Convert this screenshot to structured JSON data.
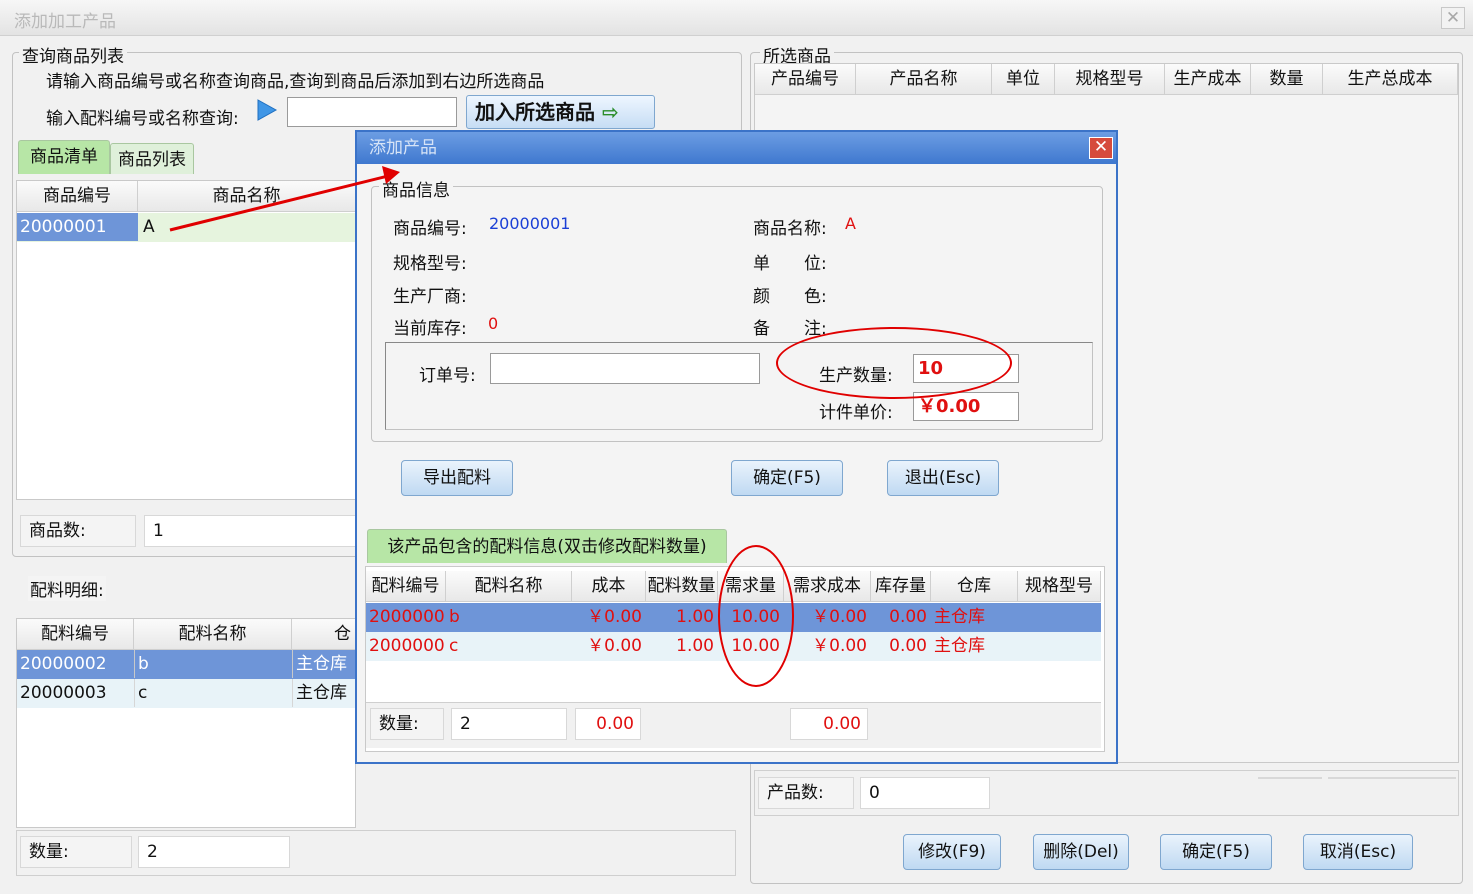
{
  "window": {
    "title": "添加加工产品",
    "close": "✕"
  },
  "query": {
    "legend": "查询商品列表",
    "hint": "请输入商品编号或名称查询商品,查询到商品后添加到右边所选商品",
    "search_label": "输入配料编号或名称查询:",
    "search_value": "",
    "add_button": "加入所选商品"
  },
  "tabs": [
    "商品清单",
    "商品列表"
  ],
  "product_table": {
    "headers": [
      "商品编号",
      "商品名称"
    ],
    "rows": [
      [
        "20000001",
        "A"
      ]
    ],
    "count_label": "商品数:",
    "count_value": "1"
  },
  "ingredients": {
    "label": "配料明细:",
    "headers": [
      "配料编号",
      "配料名称",
      "仓"
    ],
    "rows": [
      [
        "20000002",
        "b",
        "主仓库"
      ],
      [
        "20000003",
        "c",
        "主仓库"
      ]
    ],
    "count_label": "数量:",
    "count_value": "2"
  },
  "selected": {
    "legend": "所选商品",
    "headers": [
      "产品编号",
      "产品名称",
      "单位",
      "规格型号",
      "生产成本",
      "数量",
      "生产总成本"
    ],
    "count_label": "产品数:",
    "count_value": "0",
    "buttons": {
      "edit": "修改(F9)",
      "delete": "删除(Del)",
      "ok": "确定(F5)",
      "cancel": "取消(Esc)"
    }
  },
  "dialog": {
    "title": "添加产品",
    "close": "✕",
    "info_legend": "商品信息",
    "code_label": "商品编号:",
    "code_value": "20000001",
    "name_label": "商品名称:",
    "name_value": "A",
    "spec_label": "规格型号:",
    "unit_label": "单　　位:",
    "maker_label": "生产厂商:",
    "color_label": "颜　　色:",
    "stock_label": "当前库存:",
    "stock_value": "0",
    "note_label": "备　　注:",
    "order_label": "订单号:",
    "order_value": "",
    "qty_label": "生产数量:",
    "qty_value": "10",
    "price_label": "计件单价:",
    "price_value": "￥0.00",
    "btn_export": "导出配料",
    "btn_ok": "确定(F5)",
    "btn_exit": "退出(Esc)",
    "ingr_tab": "该产品包含的配料信息(双击修改配料数量)",
    "ingr_headers": [
      "配料编号",
      "配料名称",
      "成本",
      "配料数量",
      "需求量",
      "需求成本",
      "库存量",
      "仓库",
      "规格型号"
    ],
    "ingr_rows": [
      [
        "2000000",
        "b",
        "￥0.00",
        "1.00",
        "10.00",
        "￥0.00",
        "0.00",
        "主仓库",
        ""
      ],
      [
        "2000000",
        "c",
        "￥0.00",
        "1.00",
        "10.00",
        "￥0.00",
        "0.00",
        "主仓库",
        ""
      ]
    ],
    "footer_label": "数量:",
    "footer_count": "2",
    "footer_cost": "0.00",
    "footer_demand_cost": "0.00"
  },
  "colors": {
    "accent_red": "#e00000",
    "dialog_blue": "#3b73c8",
    "tab_green": "#b7e6a6"
  }
}
